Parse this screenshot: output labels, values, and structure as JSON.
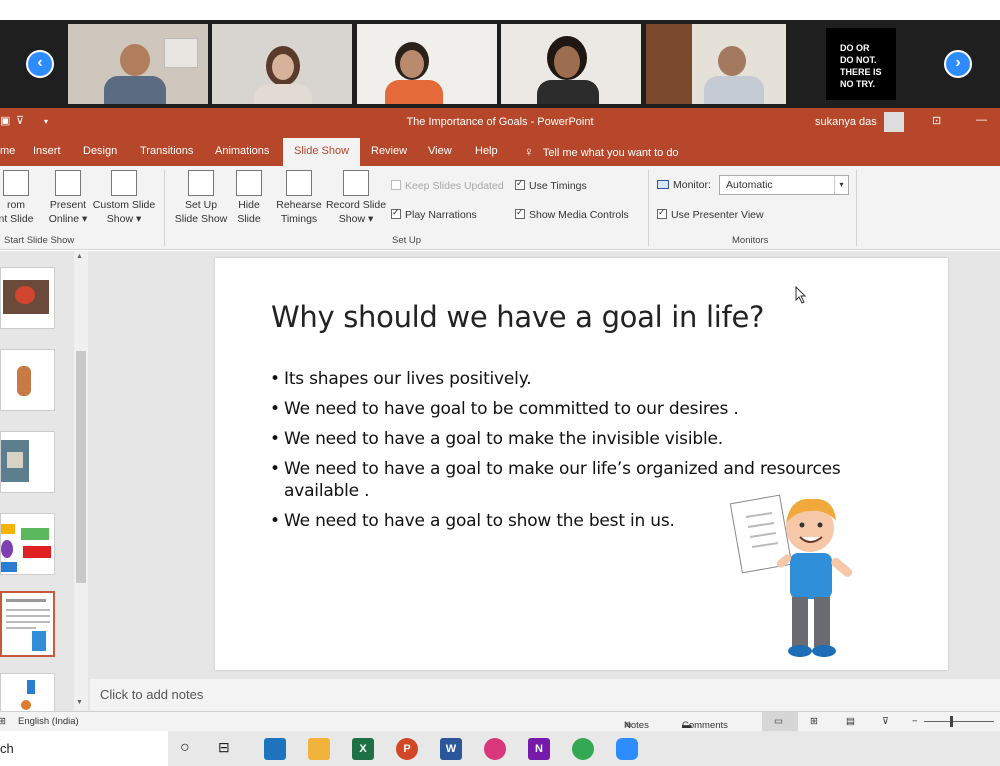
{
  "video_strip": {
    "prev_glyph": "‹",
    "next_glyph": "›",
    "quote_lines": [
      "DO OR",
      "DO NOT.",
      "THERE IS",
      "NO TRY."
    ]
  },
  "titlebar": {
    "doc_title": "The Importance of Goals  -  PowerPoint",
    "user_name": "sukanya das"
  },
  "tabs": [
    {
      "label": "me",
      "active": false
    },
    {
      "label": "Insert",
      "active": false
    },
    {
      "label": "Design",
      "active": false
    },
    {
      "label": "Transitions",
      "active": false
    },
    {
      "label": "Animations",
      "active": false
    },
    {
      "label": "Slide Show",
      "active": true
    },
    {
      "label": "Review",
      "active": false
    },
    {
      "label": "View",
      "active": false
    },
    {
      "label": "Help",
      "active": false
    }
  ],
  "tell_me": "Tell me what you want to do",
  "ribbon": {
    "start_group": {
      "from_line1": "rom",
      "from_line2": "nt Slide",
      "present_line1": "Present",
      "present_line2": "Online ▾",
      "custom_line1": "Custom Slide",
      "custom_line2": "Show ▾",
      "label": "Start Slide Show"
    },
    "setup_group": {
      "setup_line1": "Set Up",
      "setup_line2": "Slide Show",
      "hide_line1": "Hide",
      "hide_line2": "Slide",
      "rehearse_line1": "Rehearse",
      "rehearse_line2": "Timings",
      "record_line1": "Record Slide",
      "record_line2": "Show ▾",
      "keep_slides": "Keep Slides Updated",
      "play_narrations": "Play Narrations",
      "use_timings": "Use Timings",
      "show_media": "Show Media Controls",
      "label": "Set Up"
    },
    "monitors_group": {
      "monitor_label": "Monitor:",
      "monitor_value": "Automatic",
      "presenter_view": "Use Presenter View",
      "label": "Monitors"
    }
  },
  "slide": {
    "title": "Why should we have a goal in life?",
    "bullets": [
      "Its shapes our lives positively.",
      "We need to have goal to be committed to our desires .",
      "We need to have a goal to make the invisible visible.",
      "We need to have a goal to make our life’s organized and resources available .",
      "We need to have a goal to show the best in us."
    ]
  },
  "notes_placeholder": "Click to add notes",
  "statusbar": {
    "language": "English (India)",
    "notes": "Notes",
    "comments": "Comments"
  },
  "taskbar": {
    "search_text": "ch",
    "apps": [
      {
        "name": "mail-app",
        "label": "",
        "color": "#1e73be"
      },
      {
        "name": "explorer-app",
        "label": "",
        "color": "#f2b33d"
      },
      {
        "name": "excel-app",
        "label": "X",
        "color": "#1e7145"
      },
      {
        "name": "powerpoint-app",
        "label": "P",
        "color": "#d24726"
      },
      {
        "name": "word-app",
        "label": "W",
        "color": "#2b579a"
      },
      {
        "name": "paint-app",
        "label": "",
        "color": "#d9367b"
      },
      {
        "name": "onenote-app",
        "label": "N",
        "color": "#7719aa"
      },
      {
        "name": "chrome-app",
        "label": "",
        "color": "#34a853"
      },
      {
        "name": "zoom-app",
        "label": "",
        "color": "#2d8cff"
      }
    ]
  }
}
